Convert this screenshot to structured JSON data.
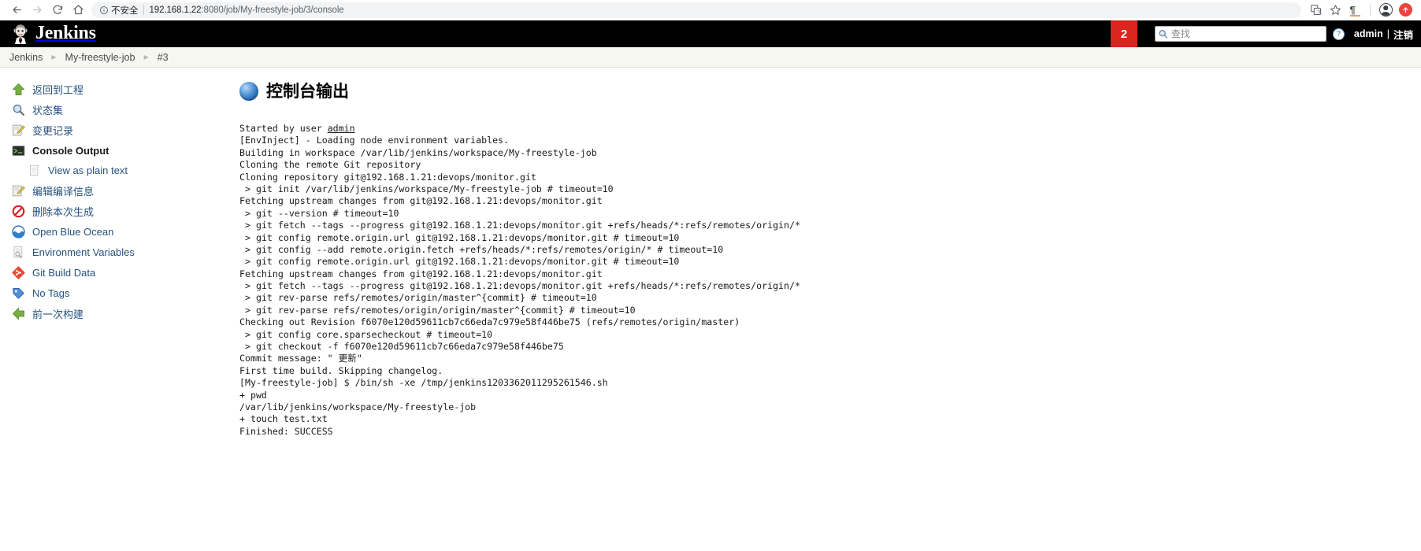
{
  "browser": {
    "back_icon": "back-arrow-icon",
    "forward_icon": "forward-arrow-icon",
    "reload_icon": "reload-icon",
    "home_icon": "home-icon",
    "security_label": "不安全",
    "url_host": "192.168.1.22",
    "url_path": ":8080/job/My-freestyle-job/3/console",
    "url_full": "192.168.1.22:8080/job/My-freestyle-job/3/console",
    "toolbar_icons": [
      "translate-icon",
      "bookmark-star-icon",
      "reading-mode-icon",
      "profile-avatar-icon",
      "update-available-icon"
    ]
  },
  "header": {
    "brand": "Jenkins",
    "logo_icon": "jenkins-butler-logo-icon",
    "build_badge": "2",
    "search_placeholder": "查找",
    "search_value": "",
    "search_icon": "search-icon",
    "help_icon": "help-icon",
    "help_label": "?",
    "user": "admin",
    "separator": "|",
    "logout": "注销"
  },
  "breadcrumb": {
    "arrow": "▶",
    "items": [
      {
        "label": "Jenkins",
        "name": "breadcrumb-jenkins"
      },
      {
        "label": "My-freestyle-job",
        "name": "breadcrumb-job"
      },
      {
        "label": "#3",
        "name": "breadcrumb-build"
      }
    ]
  },
  "sidebar": {
    "items": [
      {
        "label": "返回到工程",
        "icon": "up-arrow-icon",
        "active": false,
        "sub": false
      },
      {
        "label": "状态集",
        "icon": "magnifier-icon",
        "active": false,
        "sub": false
      },
      {
        "label": "变更记录",
        "icon": "edit-document-icon",
        "active": false,
        "sub": false
      },
      {
        "label": "Console Output",
        "icon": "terminal-icon",
        "active": true,
        "sub": false
      },
      {
        "label": "View as plain text",
        "icon": "plain-document-icon",
        "active": false,
        "sub": true
      },
      {
        "label": "编辑编译信息",
        "icon": "edit-document-icon",
        "active": false,
        "sub": false
      },
      {
        "label": "删除本次生成",
        "icon": "delete-forbidden-icon",
        "active": false,
        "sub": false
      },
      {
        "label": "Open Blue Ocean",
        "icon": "blue-ocean-icon",
        "active": false,
        "sub": false
      },
      {
        "label": "Environment Variables",
        "icon": "environment-document-icon",
        "active": false,
        "sub": false
      },
      {
        "label": "Git Build Data",
        "icon": "git-diamond-icon",
        "active": false,
        "sub": false
      },
      {
        "label": "No Tags",
        "icon": "tag-icon",
        "active": false,
        "sub": false
      },
      {
        "label": "前一次构建",
        "icon": "previous-build-arrow-icon",
        "active": false,
        "sub": false
      }
    ]
  },
  "content": {
    "title": "控制台输出",
    "title_icon": "blue-orb-icon",
    "console_lines": [
      {
        "text": "Started by user ",
        "link": "admin"
      },
      {
        "text": "[EnvInject] - Loading node environment variables."
      },
      {
        "text": "Building in workspace /var/lib/jenkins/workspace/My-freestyle-job"
      },
      {
        "text": "Cloning the remote Git repository"
      },
      {
        "text": "Cloning repository git@192.168.1.21:devops/monitor.git"
      },
      {
        "text": " > git init /var/lib/jenkins/workspace/My-freestyle-job # timeout=10"
      },
      {
        "text": "Fetching upstream changes from git@192.168.1.21:devops/monitor.git"
      },
      {
        "text": " > git --version # timeout=10"
      },
      {
        "text": " > git fetch --tags --progress git@192.168.1.21:devops/monitor.git +refs/heads/*:refs/remotes/origin/*"
      },
      {
        "text": " > git config remote.origin.url git@192.168.1.21:devops/monitor.git # timeout=10"
      },
      {
        "text": " > git config --add remote.origin.fetch +refs/heads/*:refs/remotes/origin/* # timeout=10"
      },
      {
        "text": " > git config remote.origin.url git@192.168.1.21:devops/monitor.git # timeout=10"
      },
      {
        "text": "Fetching upstream changes from git@192.168.1.21:devops/monitor.git"
      },
      {
        "text": " > git fetch --tags --progress git@192.168.1.21:devops/monitor.git +refs/heads/*:refs/remotes/origin/*"
      },
      {
        "text": " > git rev-parse refs/remotes/origin/master^{commit} # timeout=10"
      },
      {
        "text": " > git rev-parse refs/remotes/origin/origin/master^{commit} # timeout=10"
      },
      {
        "text": "Checking out Revision f6070e120d59611cb7c66eda7c979e58f446be75 (refs/remotes/origin/master)"
      },
      {
        "text": " > git config core.sparsecheckout # timeout=10"
      },
      {
        "text": " > git checkout -f f6070e120d59611cb7c66eda7c979e58f446be75"
      },
      {
        "text": "Commit message: \" 更新\""
      },
      {
        "text": "First time build. Skipping changelog."
      },
      {
        "text": "[My-freestyle-job] $ /bin/sh -xe /tmp/jenkins1203362011295261546.sh"
      },
      {
        "text": "+ pwd"
      },
      {
        "text": "/var/lib/jenkins/workspace/My-freestyle-job"
      },
      {
        "text": "+ touch test.txt"
      },
      {
        "text": "Finished: SUCCESS"
      }
    ]
  },
  "colors": {
    "jenkins_black": "#000000",
    "badge_red": "#d9251d",
    "link_blue": "#26527e",
    "breadcrumb_bg": "#f7f7f2"
  }
}
